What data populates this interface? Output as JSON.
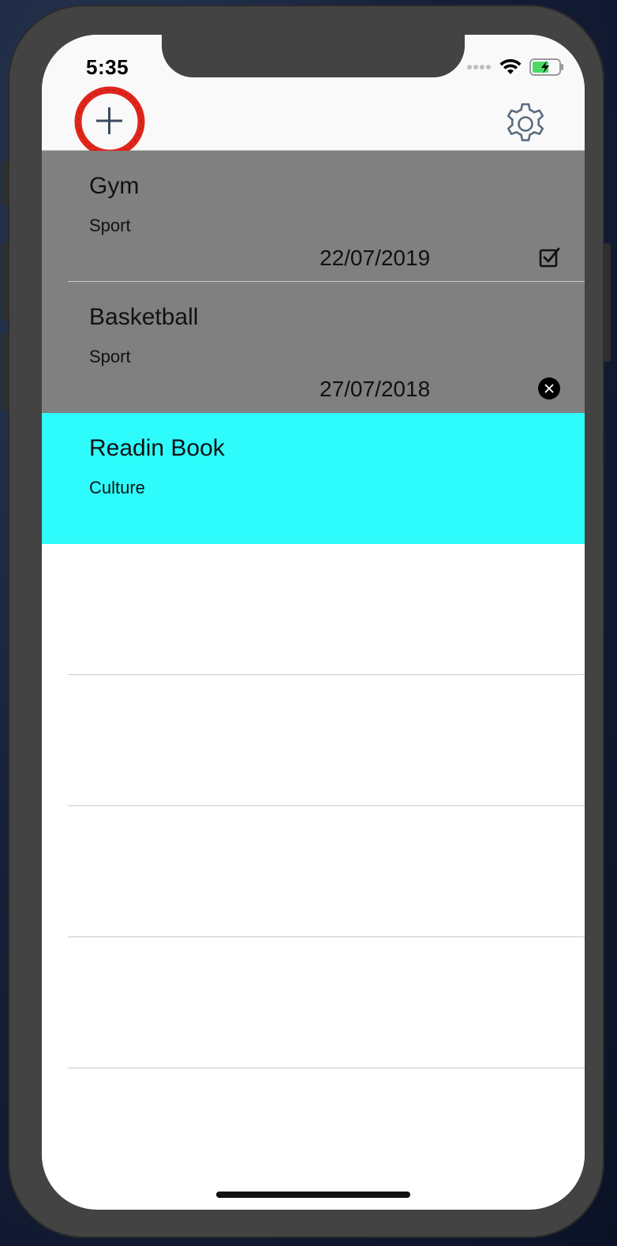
{
  "status_bar": {
    "time": "5:35",
    "icons": [
      "signal-dots-icon",
      "wifi-icon",
      "battery-charging-icon"
    ]
  },
  "nav_bar": {
    "add_icon": "plus-icon",
    "settings_icon": "gear-icon"
  },
  "tasks": [
    {
      "title": "Gym",
      "category": "Sport",
      "date": "22/07/2019",
      "status": "checkbox-checked-icon",
      "row_color": "#808080"
    },
    {
      "title": "Basketball",
      "category": "Sport",
      "date": "27/07/2018",
      "status": "close-circle-icon",
      "row_color": "#808080"
    },
    {
      "title": "Readin Book",
      "category": "Culture",
      "date": "",
      "status": "",
      "row_color": "#2efcfc"
    }
  ],
  "colors": {
    "highlight": "#2efcfc",
    "done_row": "#808080",
    "annotation_circle": "#e0261c"
  }
}
